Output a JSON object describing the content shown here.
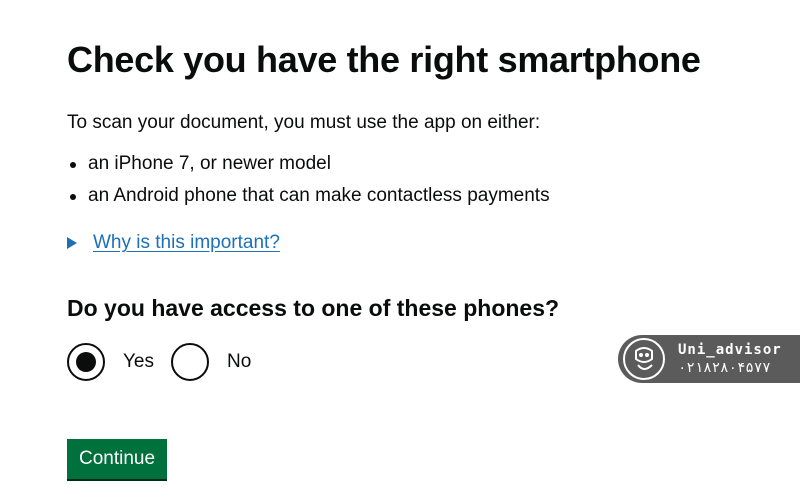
{
  "page": {
    "title": "Check you have the right smartphone",
    "intro": "To scan your document, you must use the app on either:",
    "phones": [
      "an iPhone 7, or newer model",
      "an Android phone that can make contactless payments"
    ],
    "details_link": "Why is this important?",
    "question": "Do you have access to one of these phones?",
    "options": [
      {
        "label": "Yes",
        "selected": true
      },
      {
        "label": "No",
        "selected": false
      }
    ],
    "continue_label": "Continue"
  },
  "watermark": {
    "name": "Uni_advisor",
    "phone": "۰۲۱۸۲۸۰۴۵۷۷"
  },
  "colors": {
    "text": "#0b0c0c",
    "link": "#1d70b8",
    "button": "#00703c",
    "watermark_bg": "#5b5b5b"
  }
}
